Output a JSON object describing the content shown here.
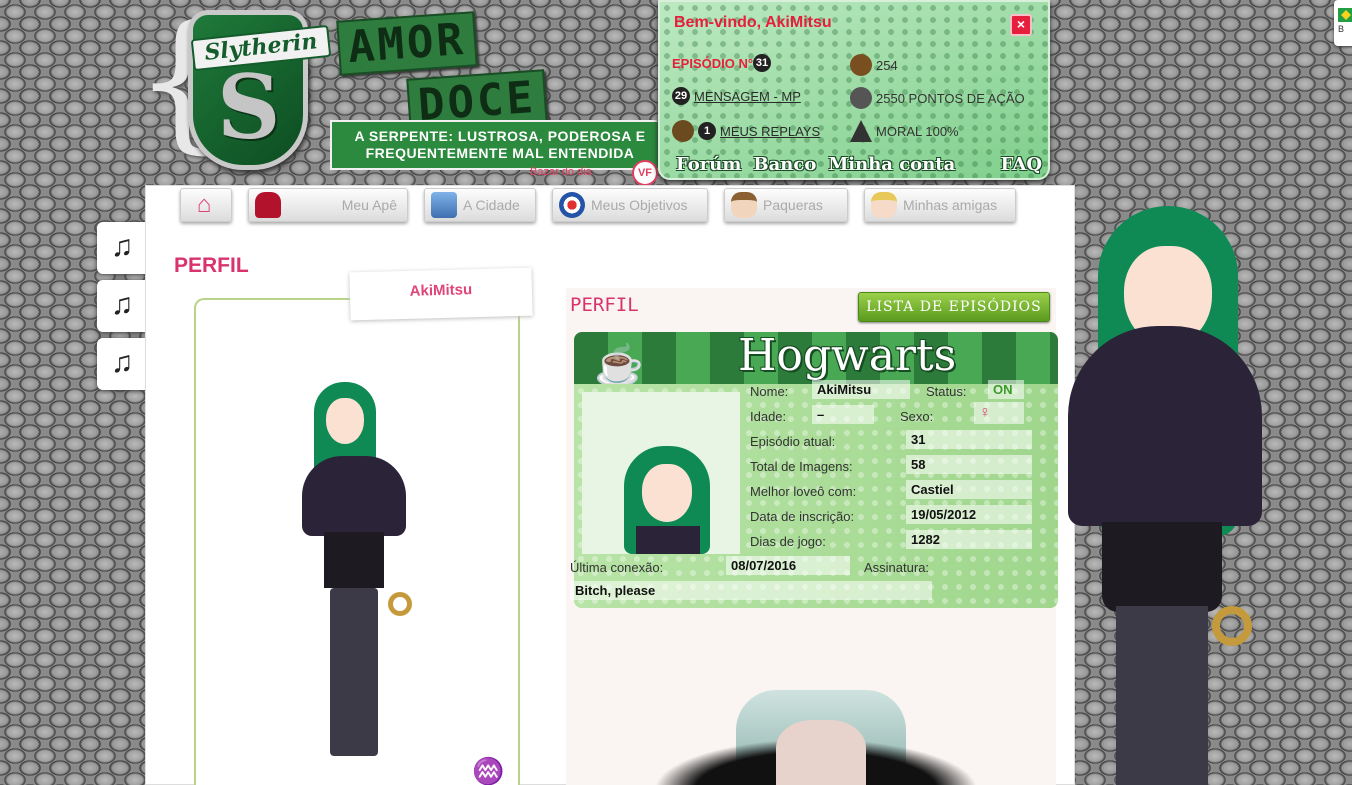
{
  "header": {
    "brace": "{",
    "crest_banner": "Slytherin",
    "crest_letter": "S",
    "title_word1": "AMOR",
    "title_word2": "DOCE",
    "tagline": "A SERPENTE: LUSTROSA, PODEROSA E FREQUENTEMENTE MAL ENTENDIDA",
    "season_note": "Bazar do dia",
    "vip_badge": "VF"
  },
  "account": {
    "welcome": "Bem-vindo, AkiMitsu",
    "close_label": "×",
    "episode_label": "EPISÓDIO N°",
    "episode_number": "31",
    "messages_count": "29",
    "messages_label": "MENSAGEM - MP",
    "replays_count": "1",
    "replays_label": "MEUS REPLAYS",
    "dollars": "254",
    "action_points": "2550 PONTOS DE AÇÃO",
    "moral": "MORAL 100%",
    "links": [
      "Forúm",
      "Banco",
      "Minha conta",
      "FAQ"
    ]
  },
  "flag_letter": "B",
  "nav": {
    "tabs": [
      {
        "label": "",
        "icon": "home-icon"
      },
      {
        "label": "Meu Apê",
        "icon": "sofa-icon"
      },
      {
        "label": "A Cidade",
        "icon": "city-icon"
      },
      {
        "label": "Meus Objetivos",
        "icon": "target-icon"
      },
      {
        "label": "Paqueras",
        "icon": "boy-portrait-icon"
      },
      {
        "label": "Minhas amigas",
        "icon": "girl-portrait-icon"
      }
    ]
  },
  "music_note": "♫",
  "page_title": "PERFIL",
  "avatar": {
    "name": "AkiMitsu",
    "zodiac": "♒"
  },
  "profile": {
    "subtitle": "PERFIL",
    "episodes_button": "LISTA DE EPISÓDIOS",
    "card_title": "Hogwarts",
    "fields": {
      "nome_label": "Nome:",
      "nome_value": "AkiMitsu",
      "status_label": "Status:",
      "status_value": "ON",
      "idade_label": "Idade:",
      "idade_value": "–",
      "sexo_label": "Sexo:",
      "sexo_value": "♀",
      "episodio_label": "Episódio atual:",
      "episodio_value": "31",
      "imagens_label": "Total de Imagens:",
      "imagens_value": "58",
      "lovelo_label": "Melhor loveô com:",
      "lovelo_value": "Castiel",
      "inscricao_label": "Data de inscrição:",
      "inscricao_value": "19/05/2012",
      "dias_label": "Dias de jogo:",
      "dias_value": "1282",
      "conexao_label": "Última conexão:",
      "conexao_value": "08/07/2016",
      "assinatura_label": "Assinatura:",
      "assinatura_value": "Bitch, please"
    }
  },
  "colors": {
    "accent_pink": "#d9336e",
    "slytherin_green": "#2b8a3e",
    "alert_red": "#e51f3c"
  }
}
